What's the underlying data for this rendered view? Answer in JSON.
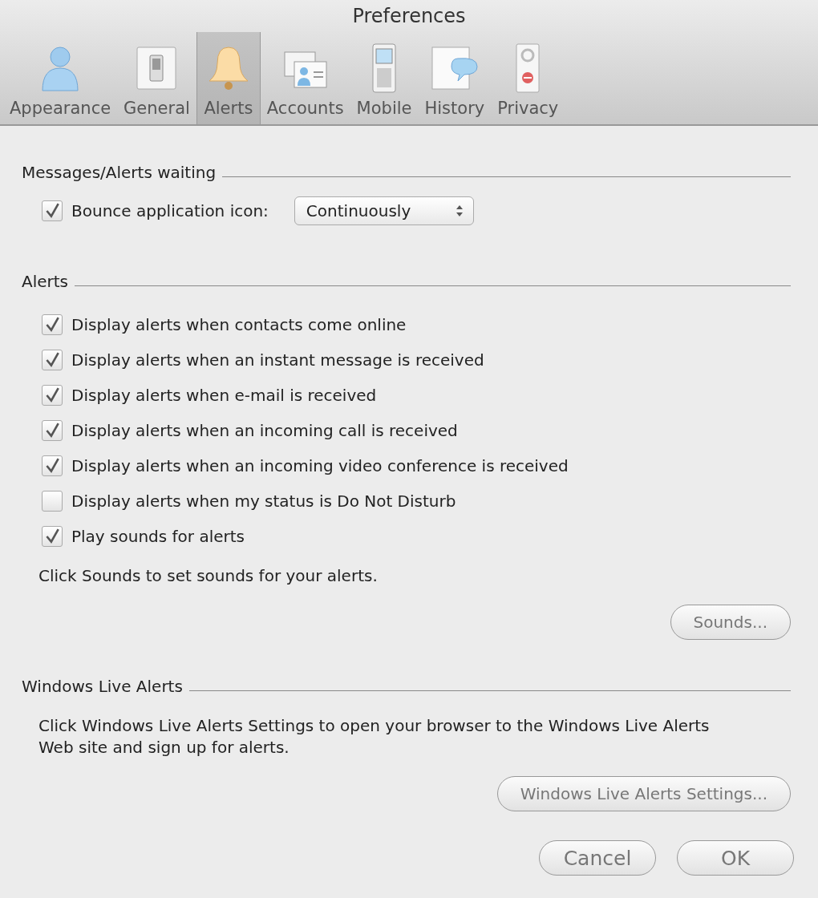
{
  "window": {
    "title": "Preferences"
  },
  "tabs": [
    {
      "label": "Appearance",
      "selected": false
    },
    {
      "label": "General",
      "selected": false
    },
    {
      "label": "Alerts",
      "selected": true
    },
    {
      "label": "Accounts",
      "selected": false
    },
    {
      "label": "Mobile",
      "selected": false
    },
    {
      "label": "History",
      "selected": false
    },
    {
      "label": "Privacy",
      "selected": false
    }
  ],
  "messages_section": {
    "heading": "Messages/Alerts waiting",
    "bounce": {
      "label": "Bounce application icon:",
      "checked": true
    },
    "bounce_select": {
      "value": "Continuously"
    }
  },
  "alerts_section": {
    "heading": "Alerts",
    "options": [
      {
        "label": "Display alerts when contacts come online",
        "checked": true
      },
      {
        "label": "Display alerts when an instant message is received",
        "checked": true
      },
      {
        "label": "Display alerts when e-mail is received",
        "checked": true
      },
      {
        "label": "Display alerts when an incoming call is received",
        "checked": true
      },
      {
        "label": "Display alerts when an incoming video conference is received",
        "checked": true
      },
      {
        "label": "Display alerts when my status is Do Not Disturb",
        "checked": false
      },
      {
        "label": "Play sounds for alerts",
        "checked": true
      }
    ],
    "note": "Click Sounds to set sounds for your alerts.",
    "button": "Sounds..."
  },
  "live_section": {
    "heading": "Windows Live Alerts",
    "text": "Click Windows Live Alerts Settings to open your browser to the Windows Live Alerts Web site and sign up for alerts.",
    "button": "Windows Live Alerts Settings..."
  },
  "buttons": [
    "Cancel",
    "OK"
  ]
}
